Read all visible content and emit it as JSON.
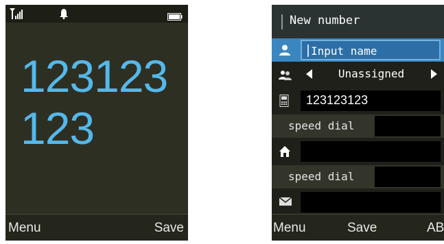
{
  "left_screen": {
    "number": "123123123",
    "softkeys": {
      "left": "Menu",
      "right": "Save"
    }
  },
  "right_screen": {
    "header": "New number",
    "name_field": {
      "placeholder": "Input name"
    },
    "group": {
      "value": "Unassigned"
    },
    "mobile_number": "123123123",
    "speed_dial_label_1": "speed dial",
    "speed_dial_label_2": "speed dial",
    "softkeys": {
      "left": "Menu",
      "center": "Save",
      "right": "ABC"
    }
  },
  "colors": {
    "number_text": "#55b8ea",
    "selected_field": "#2c6ea5",
    "screen_bg": "#2e2f23"
  },
  "icons": [
    "signal-icon",
    "bell-icon",
    "battery-icon",
    "person-icon",
    "group-icon",
    "mobile-phone-icon",
    "home-icon",
    "email-icon"
  ]
}
